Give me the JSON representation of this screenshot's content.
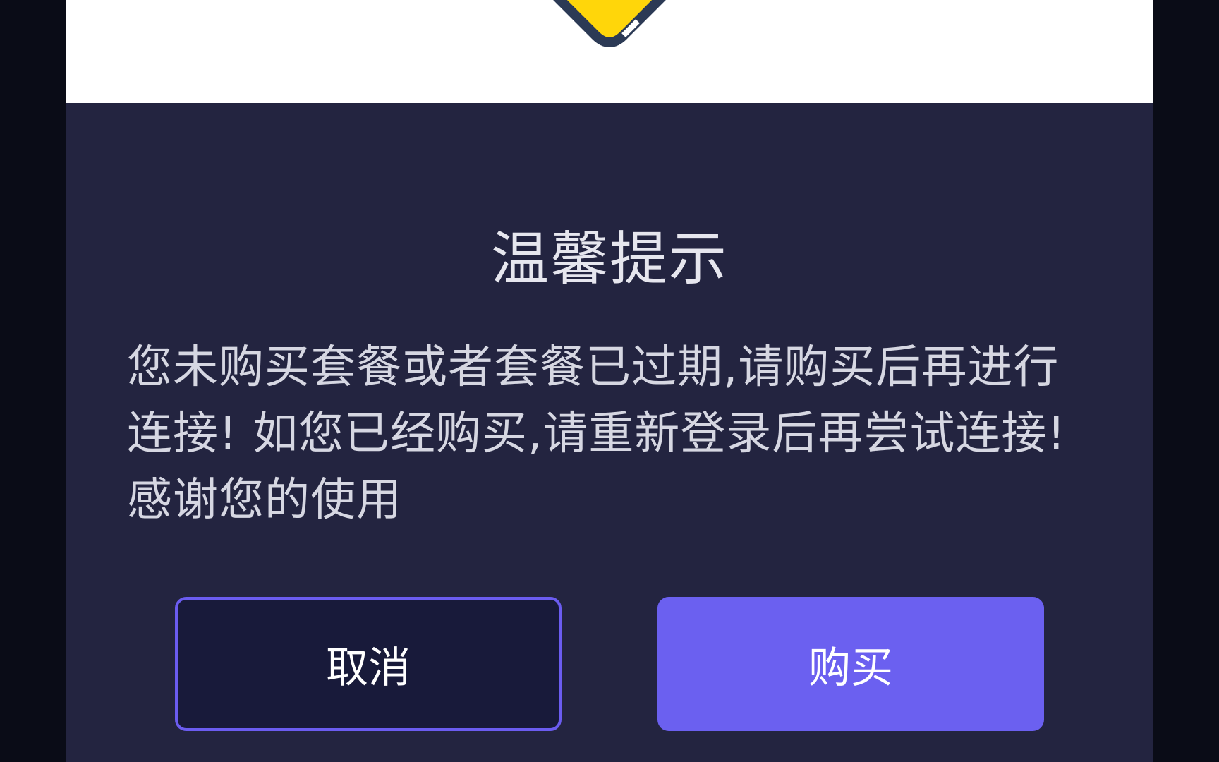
{
  "dialog": {
    "title": "温馨提示",
    "message": "您未购买套餐或者套餐已过期,请购买后再进行连接! 如您已经购买,请重新登录后再尝试连接! 感谢您的使用",
    "cancel_label": "取消",
    "buy_label": "购买",
    "icon": "warning-icon"
  },
  "colors": {
    "background": "#0a0c17",
    "dialog_body": "#232440",
    "header": "#ffffff",
    "icon_fill": "#ffd60a",
    "icon_stroke": "#2c3a55",
    "primary": "#6b60f0",
    "cancel_bg": "#181a3a"
  }
}
